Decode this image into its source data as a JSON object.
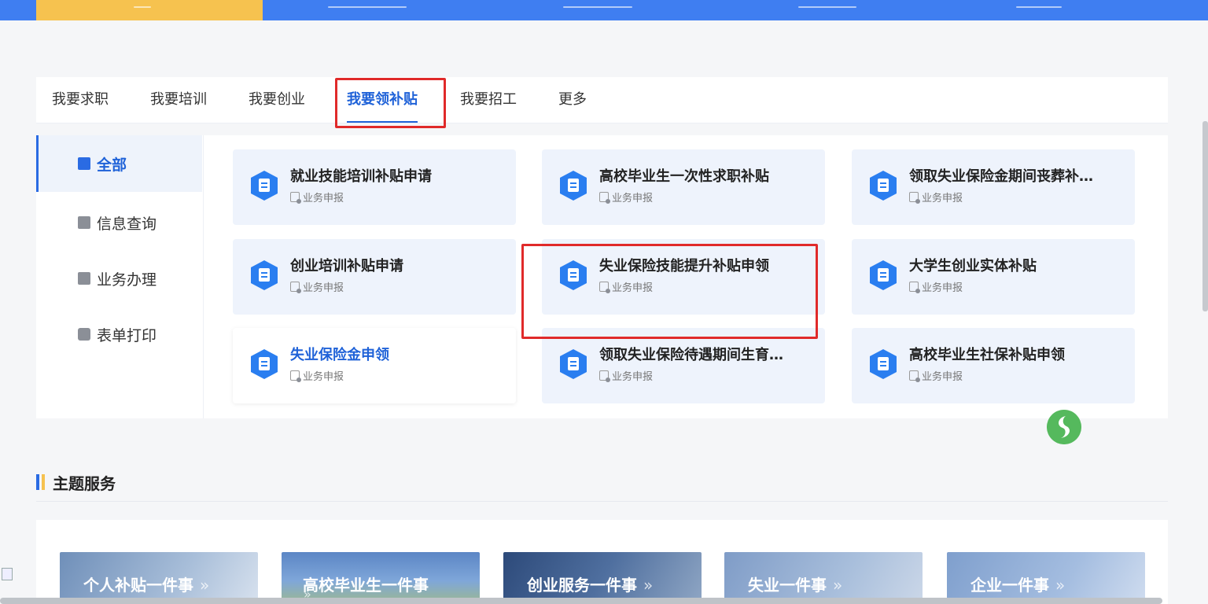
{
  "tabs": [
    {
      "label": "我要求职"
    },
    {
      "label": "我要培训"
    },
    {
      "label": "我要创业"
    },
    {
      "label": "我要领补贴"
    },
    {
      "label": "我要招工"
    },
    {
      "label": "更多"
    }
  ],
  "sidebar": {
    "items": [
      {
        "label": "全部"
      },
      {
        "label": "信息查询"
      },
      {
        "label": "业务办理"
      },
      {
        "label": "表单打印"
      }
    ]
  },
  "cards": [
    {
      "title": "就业技能培训补贴申请",
      "sub": "业务申报"
    },
    {
      "title": "高校毕业生一次性求职补贴",
      "sub": "业务申报"
    },
    {
      "title": "领取失业保险金期间丧葬补…",
      "sub": "业务申报"
    },
    {
      "title": "创业培训补贴申请",
      "sub": "业务申报"
    },
    {
      "title": "失业保险技能提升补贴申领",
      "sub": "业务申报"
    },
    {
      "title": "大学生创业实体补贴",
      "sub": "业务申报"
    },
    {
      "title": "失业保险金申领",
      "sub": "业务申报"
    },
    {
      "title": "领取失业保险待遇期间生育…",
      "sub": "业务申报"
    },
    {
      "title": "高校毕业生社保补贴申领",
      "sub": "业务申报"
    }
  ],
  "section": {
    "title": "主题服务"
  },
  "themes": [
    {
      "label": "个人补贴一件事",
      "arrow": "»"
    },
    {
      "label": "高校毕业生一件事",
      "arrow": "»"
    },
    {
      "label": "创业服务一件事",
      "arrow": "»"
    },
    {
      "label": "失业一件事",
      "arrow": "»"
    },
    {
      "label": "企业一件事",
      "arrow": "»"
    }
  ],
  "colors": {
    "accent": "#1f62d8",
    "nav": "#3f7ef1",
    "nav_active": "#f6c24f",
    "highlight": "#e02a2a"
  }
}
